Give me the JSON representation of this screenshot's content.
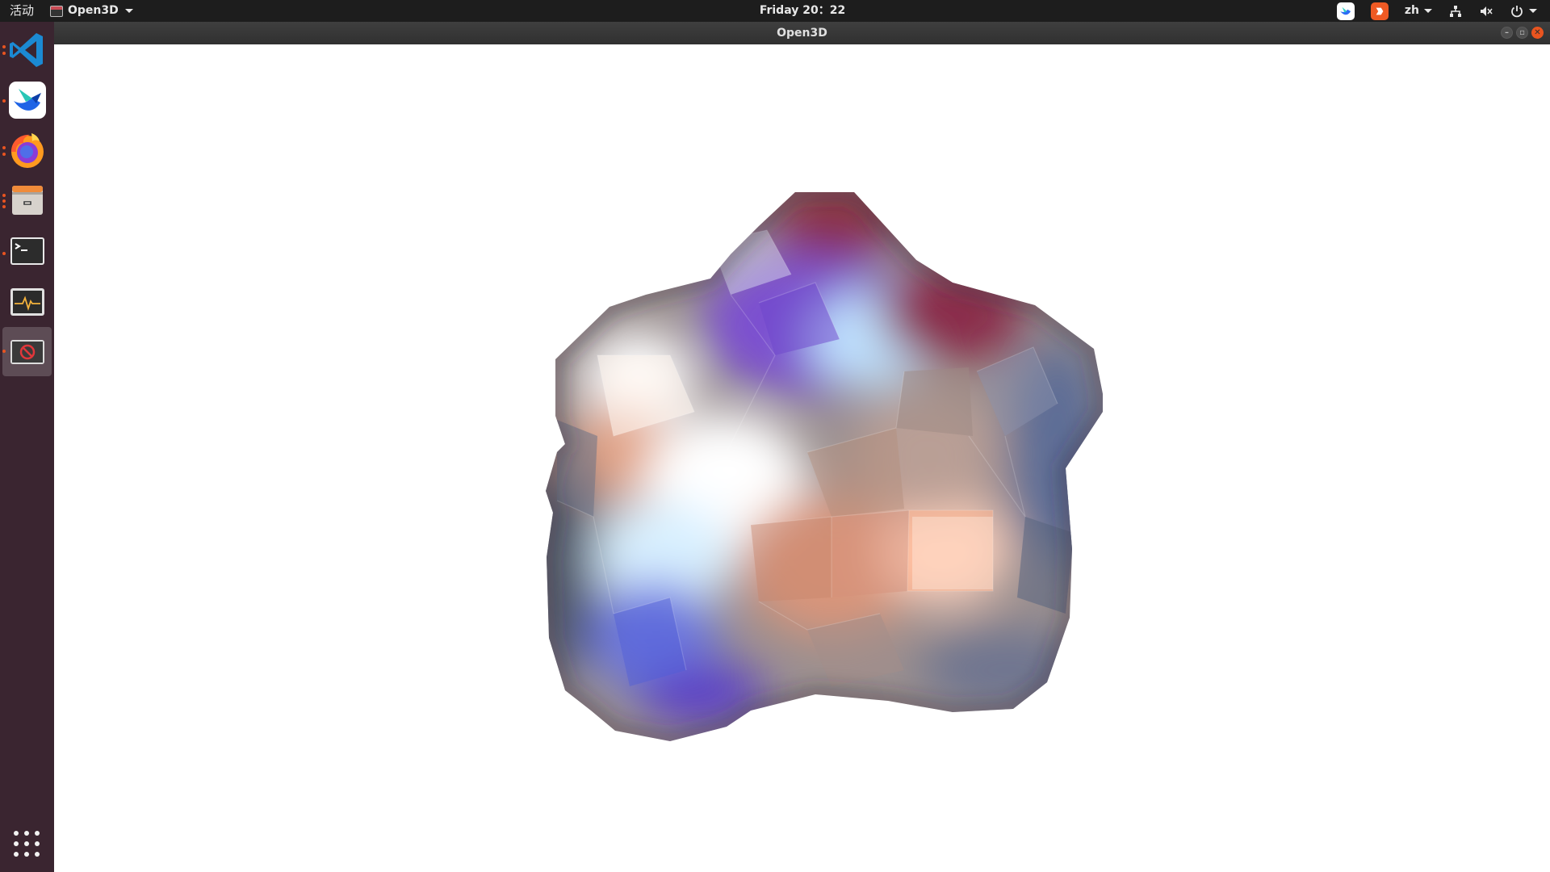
{
  "topbar": {
    "activities_label": "活动",
    "app_menu_label": "Open3D",
    "clock": "Friday 20：22",
    "language": "zh",
    "tray_icons": [
      "bird-app-icon",
      "wps-icon",
      "network-icon",
      "volume-muted-icon",
      "power-icon"
    ]
  },
  "window": {
    "title": "Open3D",
    "buttons": [
      "minimize",
      "maximize",
      "close"
    ]
  },
  "dock": {
    "apps": [
      {
        "name": "Visual Studio Code",
        "icon": "vscode-icon",
        "running": true
      },
      {
        "name": "Lark",
        "icon": "lark-icon",
        "running": true
      },
      {
        "name": "Firefox",
        "icon": "firefox-icon",
        "running": true
      },
      {
        "name": "Files",
        "icon": "files-icon",
        "running": true
      },
      {
        "name": "Terminal",
        "icon": "terminal-icon",
        "running": true
      },
      {
        "name": "System Monitor",
        "icon": "system-monitor-icon",
        "running": false
      },
      {
        "name": "Open3D",
        "icon": "open3d-app-icon",
        "running": true,
        "active": true
      }
    ],
    "show_apps_icon": "app-grid-icon"
  },
  "viewer": {
    "content": "shaded triangle mesh",
    "palette": {
      "highlight": "#ffffff",
      "warm": "#e7a587",
      "cool": "#6b8dd6",
      "purple": "#7b4fd0",
      "shadow": "#5a5f70",
      "dark_red": "#7a2a3a"
    }
  }
}
